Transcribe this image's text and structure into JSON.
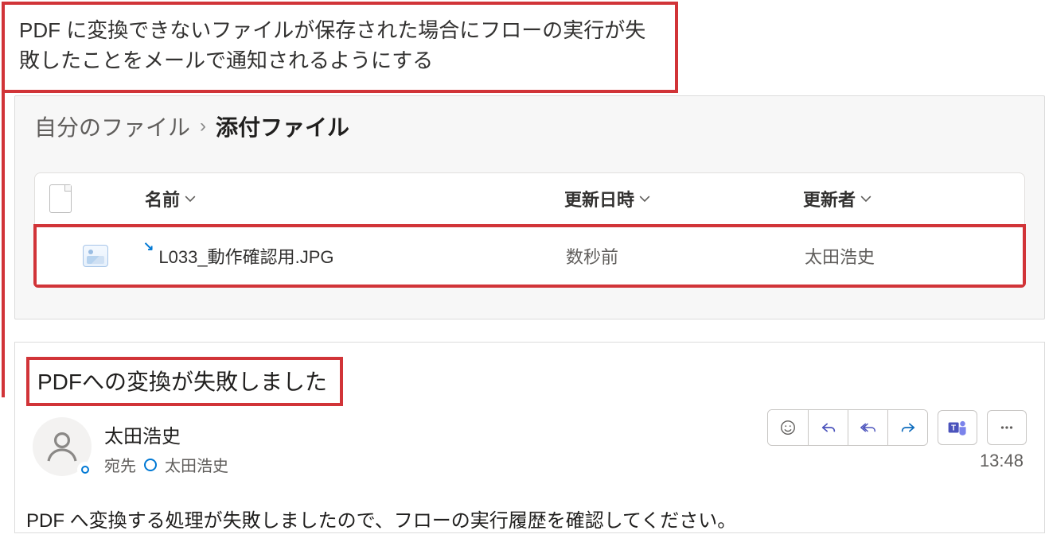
{
  "callout": {
    "description": "PDF に変換できないファイルが保存された場合にフローの実行が失敗したことをメールで通知されるようにする"
  },
  "breadcrumb": {
    "root": "自分のファイル",
    "separator": "›",
    "current": "添付ファイル"
  },
  "file_table": {
    "headers": {
      "name": "名前",
      "modified": "更新日時",
      "modified_by": "更新者"
    },
    "rows": [
      {
        "name": "L033_動作確認用.JPG",
        "modified": "数秒前",
        "modified_by": "太田浩史"
      }
    ]
  },
  "email": {
    "subject": "PDFへの変換が失敗しました",
    "from": "太田浩史",
    "to_label": "宛先",
    "to_name": "太田浩史",
    "time": "13:48",
    "body": "PDF へ変換する処理が失敗しましたので、フローの実行履歴を確認してください。",
    "actions": {
      "react": "react-icon",
      "reply": "reply-icon",
      "reply_all": "reply-all-icon",
      "forward": "forward-icon",
      "teams": "teams-icon",
      "more": "more-icon"
    }
  }
}
